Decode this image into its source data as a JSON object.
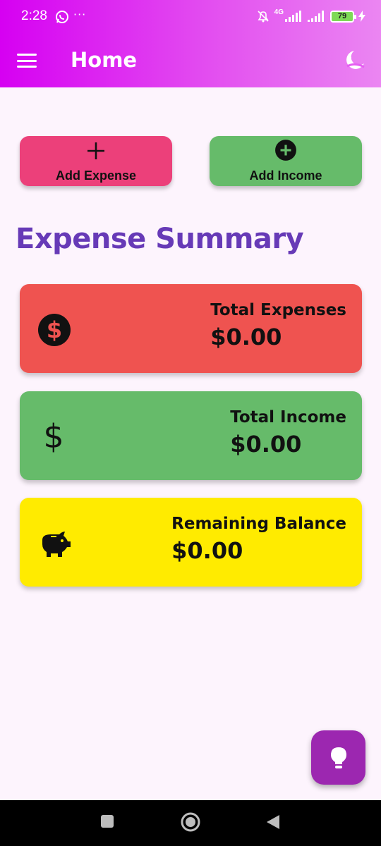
{
  "status_bar": {
    "time": "2:28",
    "dots": "···",
    "network": "4G",
    "battery": "79"
  },
  "app_bar": {
    "title": "Home"
  },
  "actions": {
    "add_expense": "Add Expense",
    "add_income": "Add Income"
  },
  "summary": {
    "title": "Expense Summary",
    "cards": [
      {
        "label": "Total Expenses",
        "value": "$0.00",
        "color": "#ef5350",
        "icon": "dollar-circle-icon"
      },
      {
        "label": "Total Income",
        "value": "$0.00",
        "color": "#66bb6a",
        "icon": "dollar-sign-icon"
      },
      {
        "label": "Remaining Balance",
        "value": "$0.00",
        "color": "#ffeb00",
        "icon": "piggy-bank-icon"
      }
    ]
  },
  "colors": {
    "app_bar_start": "#d600f2",
    "app_bar_end": "#eb86f2",
    "accent": "#673ab7",
    "fab": "#9c27b0",
    "add_expense": "#ec407a",
    "add_income": "#66bb6a"
  }
}
